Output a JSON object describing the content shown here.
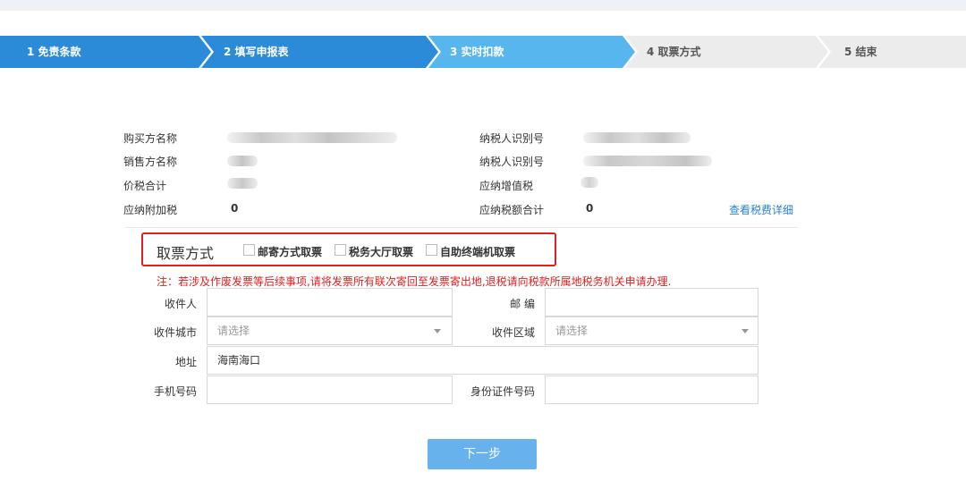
{
  "steps": [
    {
      "label": "1 免责条款",
      "state": "done"
    },
    {
      "label": "2 填写申报表",
      "state": "done"
    },
    {
      "label": "3 实时扣款",
      "state": "current"
    },
    {
      "label": "4 取票方式",
      "state": "todo"
    },
    {
      "label": "5 结束",
      "state": "todo"
    }
  ],
  "colors": {
    "step_dark": "#2c8bd8",
    "step_light": "#57b6ee",
    "step_todo": "#ececec",
    "alert": "#e02020",
    "link": "#2a7fd4",
    "button": "#67b1ec"
  },
  "info": {
    "buyer_name_label": "购买方名称",
    "buyer_taxid_label": "纳税人识别号",
    "seller_name_label": "销售方名称",
    "seller_taxid_label": "纳税人识别号",
    "total_label": "价税合计",
    "vat_label": "应纳增值税",
    "surtax_label": "应纳附加税",
    "surtax_value": "0",
    "tax_total_label": "应纳税额合计",
    "tax_total_value": "0",
    "detail_link": "查看税费详细"
  },
  "pickup": {
    "title": "取票方式",
    "options": [
      "邮寄方式取票",
      "税务大厅取票",
      "自助终端机取票"
    ]
  },
  "note": "注：若涉及作废发票等后续事项,请将发票所有联次寄回至发票寄出地,退税请向税款所属地税务机关申请办理.",
  "form": {
    "recipient_label": "收件人",
    "recipient_value": "",
    "postcode_label": "邮 编",
    "postcode_value": "",
    "city_label": "收件城市",
    "city_placeholder": "请选择",
    "district_label": "收件区域",
    "district_placeholder": "请选择",
    "address_label": "地址",
    "address_value": "海南海口",
    "phone_label": "手机号码",
    "phone_value": "",
    "idcard_label": "身份证件号码",
    "idcard_value": ""
  },
  "next_button": "下一步"
}
